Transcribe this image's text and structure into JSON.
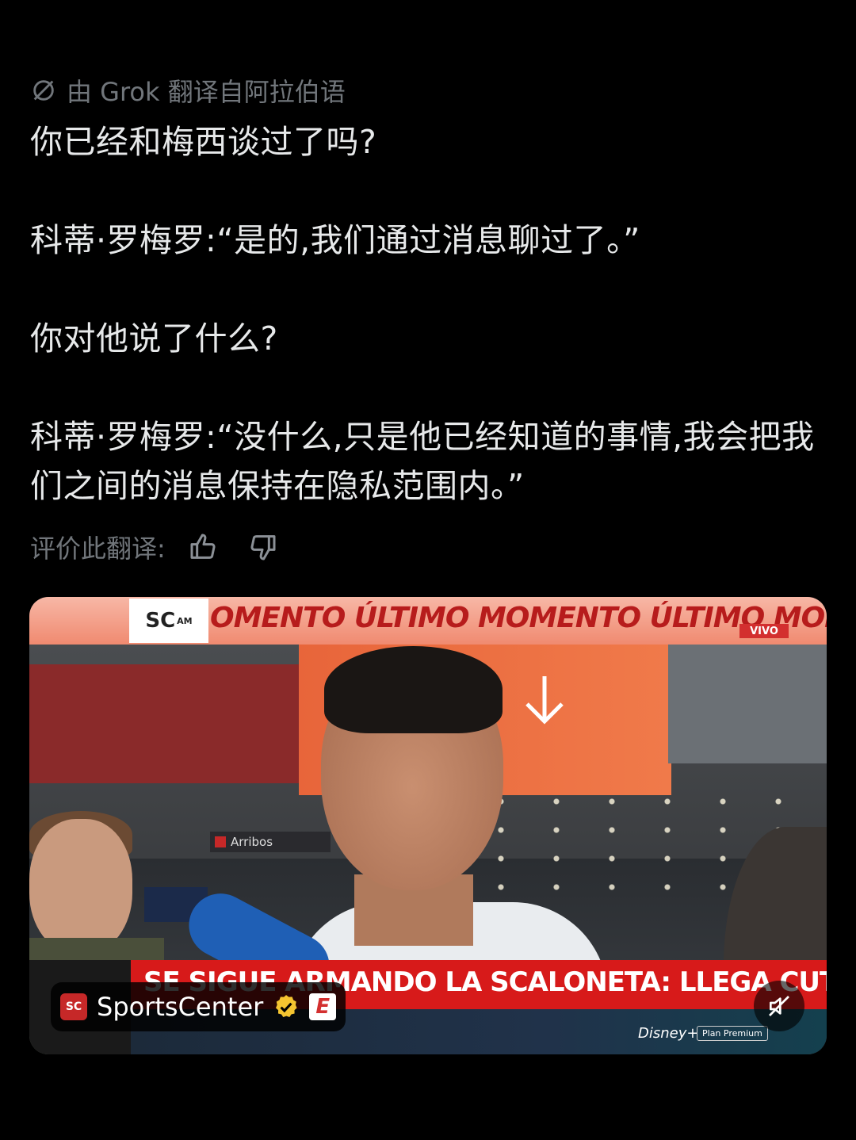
{
  "translation_notice": "由 Grok 翻译自阿拉伯语",
  "tweet": {
    "paragraphs": [
      "你已经和梅西谈过了吗?",
      "科蒂·罗梅罗:“是的,我们通过消息聊过了。”",
      "你对他说了什么?",
      "科蒂·罗梅罗:“没什么,只是他已经知道的事情,我会把我们之间的消息保持在隐私范围内。”"
    ]
  },
  "rate_translation": {
    "label": "评价此翻译:",
    "like_icon": "thumbs-up-icon",
    "dislike_icon": "thumbs-down-icon"
  },
  "video": {
    "top_banner_logo": "SC",
    "top_banner_logo_suffix": "AM",
    "top_banner_text": "OMENTO ÚLTIMO MOMENTO ÚLTIMO MOMENTO Ú",
    "live_badge": "VIVO",
    "arribos_sign": "Arribos",
    "lower_third": "SE SIGUE ARMANDO LA SCALONETA: LLEGA CUTI ROMERO AL PAÍS",
    "disney_logo": "Disney+",
    "plan_label": "Plan Premium",
    "channel": {
      "avatar_text": "SC",
      "name": "SportsCenter",
      "verified_icon": "verified-badge-icon",
      "affiliate_badge": "E"
    },
    "mute_icon": "muted-speaker-icon"
  },
  "colors": {
    "background": "#000000",
    "primary_text": "#e7e9ea",
    "secondary_text": "#71767b",
    "banner_red": "#d71a1a",
    "verified_gold": "#f4c430"
  }
}
